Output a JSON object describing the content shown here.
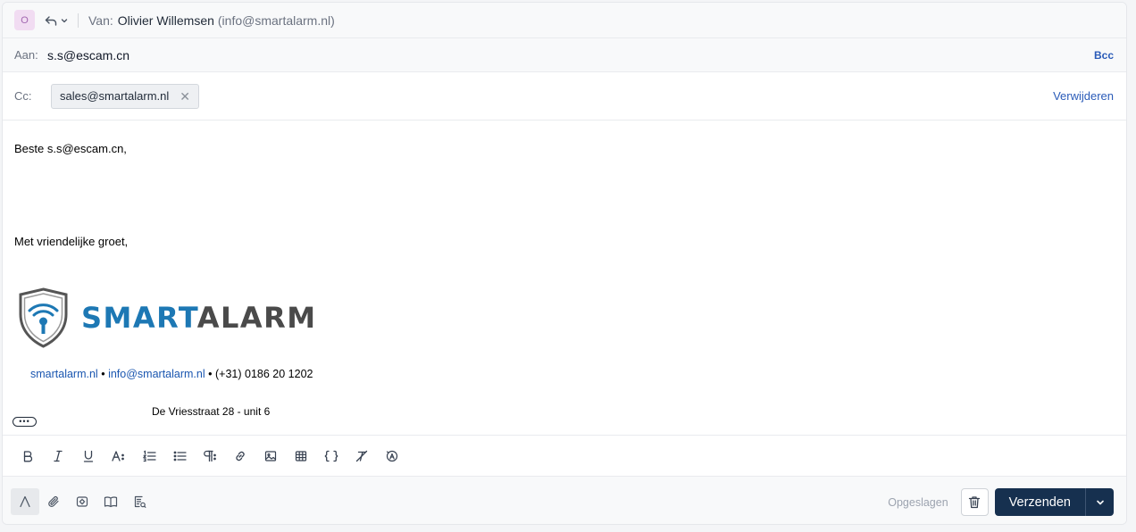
{
  "from": {
    "avatar_letter": "O",
    "label": "Van:",
    "name": "Olivier Willemsen",
    "email": "(info@smartalarm.nl)"
  },
  "to": {
    "label": "Aan:",
    "value": "s.s@escam.cn",
    "bcc_label": "Bcc"
  },
  "cc": {
    "label": "Cc:",
    "chip": "sales@smartalarm.nl",
    "remove_label": "Verwijderen"
  },
  "body": {
    "greeting": "Beste s.s@escam.cn,",
    "closing": "Met vriendelijke groet,",
    "logo_smart": "SMART",
    "logo_alarm": "ALARM",
    "website": "smartalarm.nl",
    "bullet": "•",
    "email": "info@smartalarm.nl",
    "phone": "(+31) 0186 20 1202",
    "address": "De Vriesstraat 28 - unit 6"
  },
  "toolbar": {
    "icons": [
      "bold-icon",
      "italic-icon",
      "underline-icon",
      "font-size-icon",
      "ordered-list-icon",
      "bullet-list-icon",
      "paragraph-icon",
      "link-icon",
      "image-icon",
      "table-icon",
      "code-braces-icon",
      "clear-format-icon",
      "spellcheck-icon"
    ]
  },
  "footer": {
    "saved_label": "Opgeslagen",
    "send_label": "Verzenden"
  },
  "colors": {
    "link": "#2a5bb8",
    "send_button": "#16304f",
    "logo_blue": "#1d78b4",
    "logo_gray": "#4a4a4a"
  }
}
